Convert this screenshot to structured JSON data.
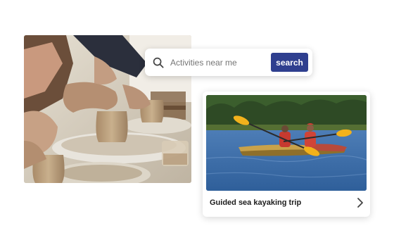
{
  "search": {
    "placeholder": "Activities near me",
    "button_label": "search",
    "button_color": "#2f3f8f"
  },
  "featured_photo": {
    "subject": "pottery-wheel-photo"
  },
  "activity_card": {
    "title": "Guided sea kayaking trip",
    "image": "kayaking-photo",
    "action_icon": "chevron-right-icon"
  }
}
